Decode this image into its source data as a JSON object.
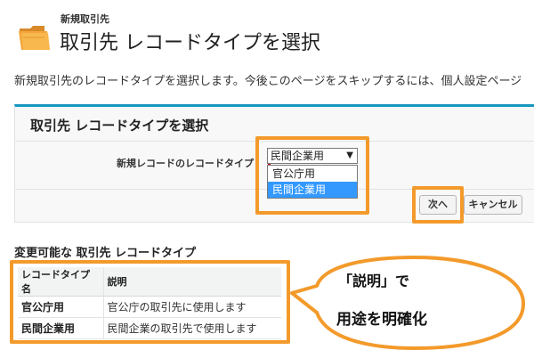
{
  "header": {
    "subtitle": "新規取引先",
    "title": "取引先 レコードタイプを選択"
  },
  "intro": "新規取引先のレコードタイプを選択します。今後このページをスキップするには、個人設定ページ",
  "panel": {
    "title": "取引先 レコードタイプを選択",
    "field_label": "新規レコードのレコードタイプ",
    "select": {
      "value": "民間企業用",
      "arrow": "▼",
      "options": [
        "官公庁用",
        "民間企業用"
      ]
    },
    "next_label": "次へ",
    "cancel_label": "キャンセル"
  },
  "section_title": "変更可能な 取引先 レコードタイプ",
  "table": {
    "headers": [
      "レコードタイプ名",
      "説明"
    ],
    "rows": [
      {
        "name": "官公庁用",
        "description": "官公庁の取引先に使用します"
      },
      {
        "name": "民間企業用",
        "description": "民間企業の取引先で使用します"
      }
    ]
  },
  "callout": {
    "line1": "「説明」で",
    "line2": "用途を明確化"
  },
  "colors": {
    "accent": "#1797c0",
    "highlight": "#f39a2b",
    "selected_option": "#3399ff",
    "required": "#cc0000"
  },
  "icons": {
    "header_icon": "folder-icon"
  }
}
